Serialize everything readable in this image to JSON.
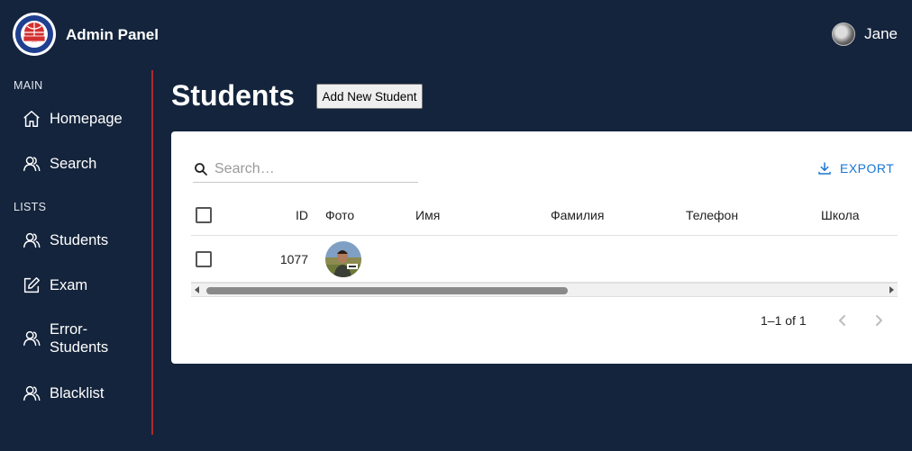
{
  "app": {
    "title": "Admin Panel",
    "logo_text": "ALA-TOO",
    "logo_year": "1996"
  },
  "user": {
    "name": "Jane"
  },
  "sidebar": {
    "sections": [
      {
        "label": "MAIN",
        "items": [
          {
            "label": "Homepage",
            "icon": "home-icon"
          },
          {
            "label": "Search",
            "icon": "users-icon"
          }
        ]
      },
      {
        "label": "LISTS",
        "items": [
          {
            "label": "Students",
            "icon": "users-icon"
          },
          {
            "label": "Exam",
            "icon": "edit-icon"
          },
          {
            "label": "Error-Students",
            "icon": "users-icon"
          },
          {
            "label": "Blacklist",
            "icon": "users-icon"
          }
        ]
      }
    ]
  },
  "page": {
    "title": "Students",
    "add_button": "Add New Student"
  },
  "table": {
    "search_placeholder": "Search…",
    "export_label": "EXPORT",
    "columns": [
      "ID",
      "Фото",
      "Имя",
      "Фамилия",
      "Телефон",
      "Школа"
    ],
    "rows": [
      {
        "id": "1077",
        "photo": "student-photo",
        "first_name": "",
        "last_name": "",
        "phone": "",
        "school": ""
      }
    ],
    "pagination": "1–1 of 1"
  },
  "colors": {
    "background": "#14243c",
    "accent": "#1976d2",
    "sidebar_divider": "#b02a2a"
  }
}
